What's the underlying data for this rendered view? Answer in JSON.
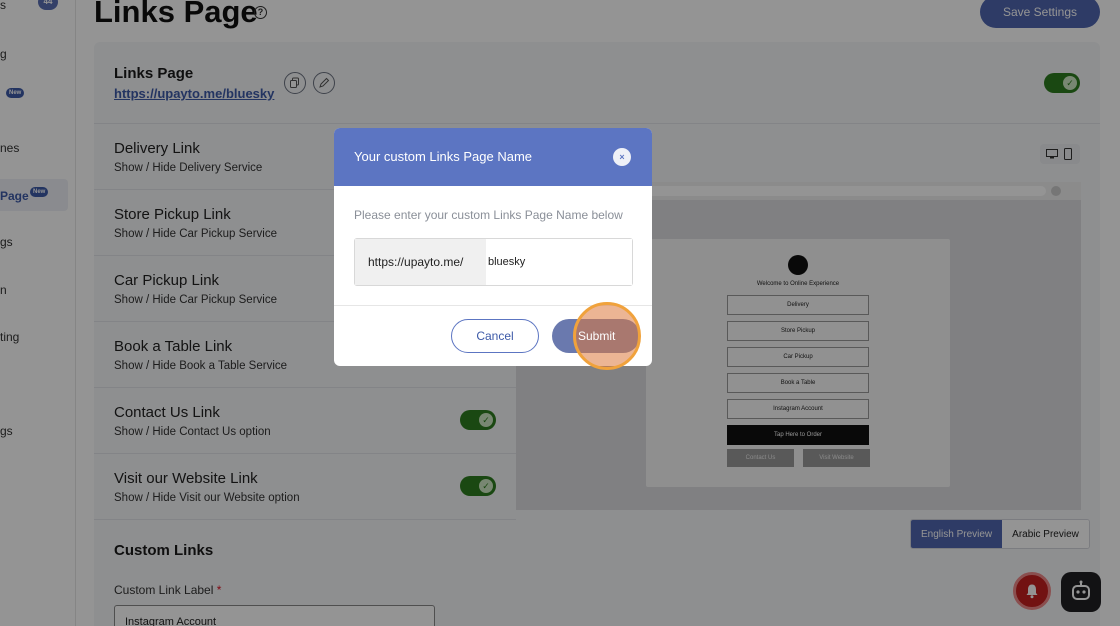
{
  "sidebar": {
    "items": [
      {
        "label": "s",
        "badge_count": "44"
      },
      {
        "label": "g"
      },
      {
        "label": "",
        "badge_new": "New"
      },
      {
        "label": "nes"
      },
      {
        "label": "Page",
        "badge_new": "New"
      },
      {
        "label": "gs"
      },
      {
        "label": "n"
      },
      {
        "label": "ting"
      },
      {
        "label": "gs"
      }
    ]
  },
  "header": {
    "title": "Links Page",
    "help_icon": "?",
    "save_label": "Save Settings"
  },
  "links_page": {
    "title": "Links Page",
    "url": "https://upayto.me/bluesky",
    "copy_icon": "copy-icon",
    "edit_icon": "pencil-icon"
  },
  "link_rows": [
    {
      "title": "Delivery Link",
      "subtitle": "Show / Hide Delivery Service"
    },
    {
      "title": "Store Pickup Link",
      "subtitle": "Show / Hide Car Pickup Service"
    },
    {
      "title": "Car Pickup Link",
      "subtitle": "Show / Hide Car Pickup Service"
    },
    {
      "title": "Book a Table Link",
      "subtitle": "Show / Hide Book a Table Service"
    },
    {
      "title": "Contact Us Link",
      "subtitle": "Show / Hide Contact Us option",
      "enabled": true
    },
    {
      "title": "Visit our Website Link",
      "subtitle": "Show / Hide Visit our Website option",
      "enabled": true
    }
  ],
  "custom_links": {
    "title": "Custom Links",
    "label": "Custom Link Label",
    "required_mark": "*",
    "input_value": "Instagram Account"
  },
  "preview": {
    "welcome": "Welcome to Online Experience",
    "buttons": [
      "Delivery",
      "Store Pickup",
      "Car Pickup",
      "Book a Table",
      "Instagram Account"
    ],
    "cta": "Tap Here to Order",
    "contact": "Contact Us",
    "website": "Visit Website",
    "tabs": {
      "english": "English Preview",
      "arabic": "Arabic Preview"
    }
  },
  "modal": {
    "title": "Your custom Links Page Name",
    "close": "×",
    "hint": "Please enter your custom Links Page Name below",
    "url_prefix": "https://upayto.me/",
    "url_value": "bluesky",
    "cancel": "Cancel",
    "submit": "Submit"
  },
  "colors": {
    "accent": "#5067b0",
    "modal_header": "#5c75c2",
    "toggle_on": "#2e7d1f",
    "highlight": "#f0a23c"
  }
}
